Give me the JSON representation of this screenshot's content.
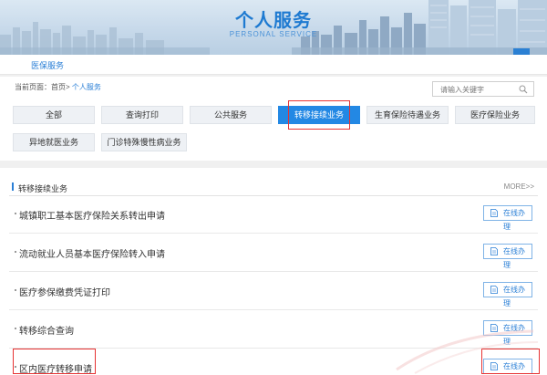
{
  "banner": {
    "title": "个人服务",
    "subtitle": "PERSONAL SERVICE"
  },
  "subnav": {
    "item": "医保服务"
  },
  "breadcrumb": {
    "prefix": "当前页面：",
    "home": "首页>",
    "current": "个人服务"
  },
  "search": {
    "placeholder": "请输入关键字"
  },
  "categories": [
    "全部",
    "查询打印",
    "公共服务",
    "转移接续业务",
    "生育保险待遇业务",
    "医疗保险业务",
    "异地就医业务",
    "门诊特殊慢性病业务"
  ],
  "active_category": "转移接续业务",
  "section": {
    "title": "转移接续业务",
    "more": "MORE>>"
  },
  "rows": [
    {
      "label": "城镇职工基本医疗保险关系转出申请",
      "button": "在线办理"
    },
    {
      "label": "流动就业人员基本医疗保险转入申请",
      "button": "在线办理"
    },
    {
      "label": "医疗参保缴费凭证打印",
      "button": "在线办理"
    },
    {
      "label": "转移综合查询",
      "button": "在线办理"
    },
    {
      "label": "区内医疗转移申请",
      "button": "在线办理"
    }
  ],
  "colors": {
    "accent": "#2388e4",
    "highlight_outline": "#e63232"
  }
}
